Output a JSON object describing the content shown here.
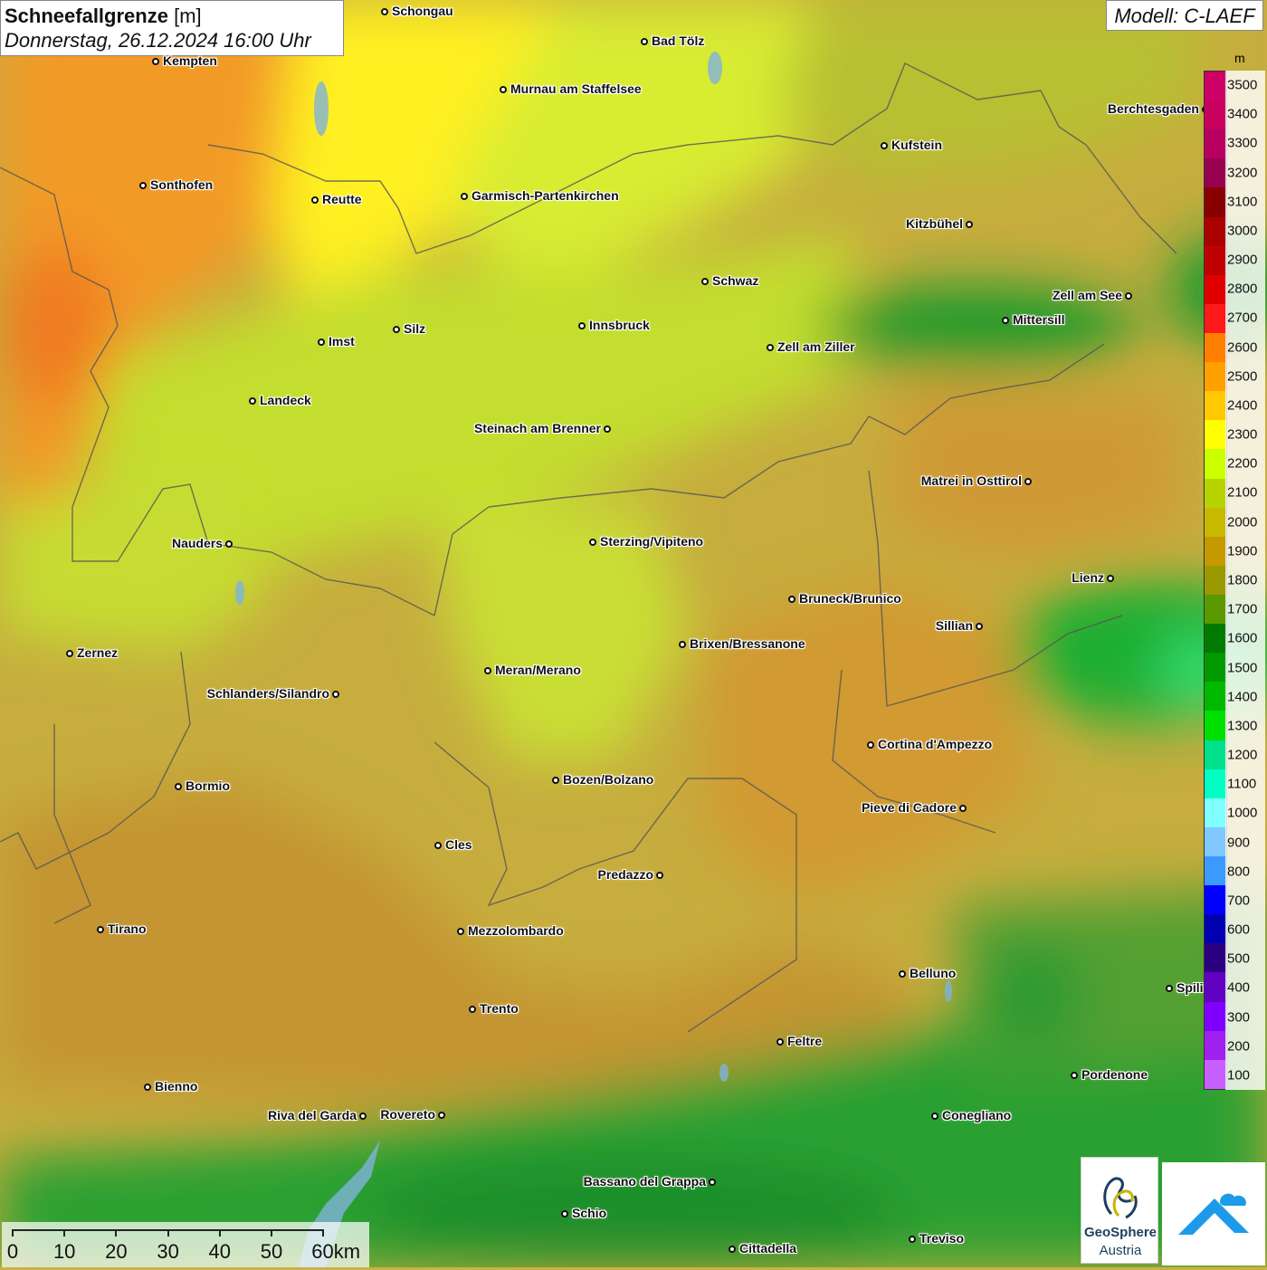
{
  "header": {
    "title_bold": "Schneefallgrenze",
    "title_unit": "[m]",
    "datetime": "Donnerstag, 26.12.2024 16:00 Uhr",
    "model": "Modell: C-LAEF"
  },
  "legend": {
    "unit": "m",
    "steps": [
      {
        "label": "3500",
        "color": "#cc0066"
      },
      {
        "label": "3400",
        "color": "#c8005e"
      },
      {
        "label": "3300",
        "color": "#b80060"
      },
      {
        "label": "3200",
        "color": "#9a0050"
      },
      {
        "label": "3100",
        "color": "#880000"
      },
      {
        "label": "3000",
        "color": "#aa0000"
      },
      {
        "label": "2900",
        "color": "#c00000"
      },
      {
        "label": "2800",
        "color": "#e00000"
      },
      {
        "label": "2700",
        "color": "#ff1a1a"
      },
      {
        "label": "2600",
        "color": "#ff7f00"
      },
      {
        "label": "2500",
        "color": "#ff9f00"
      },
      {
        "label": "2400",
        "color": "#ffc800"
      },
      {
        "label": "2300",
        "color": "#ffff00"
      },
      {
        "label": "2200",
        "color": "#ccff00"
      },
      {
        "label": "2100",
        "color": "#b8d400"
      },
      {
        "label": "2000",
        "color": "#c8b800"
      },
      {
        "label": "1900",
        "color": "#c49a00"
      },
      {
        "label": "1800",
        "color": "#9a9a00"
      },
      {
        "label": "1700",
        "color": "#5a9a00"
      },
      {
        "label": "1600",
        "color": "#007a00"
      },
      {
        "label": "1500",
        "color": "#009a00"
      },
      {
        "label": "1400",
        "color": "#00b800"
      },
      {
        "label": "1300",
        "color": "#00e000"
      },
      {
        "label": "1200",
        "color": "#00e08a"
      },
      {
        "label": "1100",
        "color": "#00ffc0"
      },
      {
        "label": "1000",
        "color": "#80ffff"
      },
      {
        "label": "900",
        "color": "#80c8ff"
      },
      {
        "label": "800",
        "color": "#3c9aff"
      },
      {
        "label": "700",
        "color": "#0000ff"
      },
      {
        "label": "600",
        "color": "#0000b0"
      },
      {
        "label": "500",
        "color": "#2a0080"
      },
      {
        "label": "400",
        "color": "#6000c0"
      },
      {
        "label": "300",
        "color": "#8000ff"
      },
      {
        "label": "200",
        "color": "#a020f0"
      },
      {
        "label": "100",
        "color": "#c860ff"
      }
    ]
  },
  "cities": [
    {
      "name": "Schongau",
      "side": "right"
    },
    {
      "name": "Bad Tölz",
      "side": "right"
    },
    {
      "name": "Kempten",
      "side": "right"
    },
    {
      "name": "Murnau am Staffelsee",
      "side": "right"
    },
    {
      "name": "Berchtesgaden",
      "side": "left"
    },
    {
      "name": "Kufstein",
      "side": "right"
    },
    {
      "name": "Sonthofen",
      "side": "right"
    },
    {
      "name": "Reutte",
      "side": "right"
    },
    {
      "name": "Garmisch-Partenkirchen",
      "side": "right"
    },
    {
      "name": "Kitzbühel",
      "side": "left"
    },
    {
      "name": "Schwaz",
      "side": "right"
    },
    {
      "name": "Zell am See",
      "side": "left"
    },
    {
      "name": "Mittersill",
      "side": "right"
    },
    {
      "name": "Innsbruck",
      "side": "right"
    },
    {
      "name": "Silz",
      "side": "right"
    },
    {
      "name": "Imst",
      "side": "right"
    },
    {
      "name": "Zell am Ziller",
      "side": "right"
    },
    {
      "name": "Landeck",
      "side": "right"
    },
    {
      "name": "Steinach am Brenner",
      "side": "left"
    },
    {
      "name": "Matrei in Osttirol",
      "side": "left"
    },
    {
      "name": "Nauders",
      "side": "left"
    },
    {
      "name": "Sterzing/Vipiteno",
      "side": "right"
    },
    {
      "name": "Lienz",
      "side": "left"
    },
    {
      "name": "Bruneck/Brunico",
      "side": "right"
    },
    {
      "name": "Sillian",
      "side": "left"
    },
    {
      "name": "Brixen/Bressanone",
      "side": "right"
    },
    {
      "name": "Zernez",
      "side": "right"
    },
    {
      "name": "Meran/Merano",
      "side": "right"
    },
    {
      "name": "Schlanders/Silandro",
      "side": "left"
    },
    {
      "name": "Cortina d'Ampezzo",
      "side": "right"
    },
    {
      "name": "Bozen/Bolzano",
      "side": "right"
    },
    {
      "name": "Bormio",
      "side": "right"
    },
    {
      "name": "Pieve di Cadore",
      "side": "left"
    },
    {
      "name": "Cles",
      "side": "right"
    },
    {
      "name": "Predazzo",
      "side": "left"
    },
    {
      "name": "Tirano",
      "side": "right"
    },
    {
      "name": "Mezzolombardo",
      "side": "right"
    },
    {
      "name": "Belluno",
      "side": "right"
    },
    {
      "name": "Spili",
      "side": "right"
    },
    {
      "name": "Trento",
      "side": "right"
    },
    {
      "name": "Feltre",
      "side": "right"
    },
    {
      "name": "Pordenone",
      "side": "right"
    },
    {
      "name": "Bienno",
      "side": "right"
    },
    {
      "name": "Riva del Garda",
      "side": "left"
    },
    {
      "name": "Rovereto",
      "side": "left"
    },
    {
      "name": "Conegliano",
      "side": "right"
    },
    {
      "name": "Bassano del Grappa",
      "side": "left"
    },
    {
      "name": "Schio",
      "side": "right"
    },
    {
      "name": "Treviso",
      "side": "right"
    },
    {
      "name": "Cittadella",
      "side": "right"
    }
  ],
  "scalebar": {
    "labels": [
      "0",
      "10",
      "20",
      "30",
      "40",
      "50",
      "60km"
    ]
  },
  "logo": {
    "line1": "GeoSphere",
    "line2": "Austria"
  }
}
